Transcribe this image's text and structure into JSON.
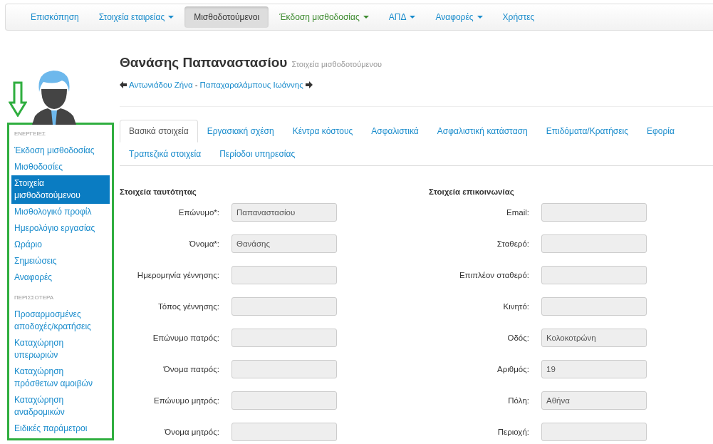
{
  "navbar": {
    "items": [
      {
        "label": "Επισκόπηση",
        "caret": false,
        "selected": false,
        "color": "#1a8ccc"
      },
      {
        "label": "Στοιχεία εταιρείας",
        "caret": true,
        "selected": false,
        "color": "#1a8ccc"
      },
      {
        "label": "Μισθοδοτούμενοι",
        "caret": false,
        "selected": true,
        "color": "#333333"
      },
      {
        "label": "Έκδοση μισθοδοσίας",
        "caret": true,
        "selected": false,
        "color": "#3c8a2e"
      },
      {
        "label": "ΑΠΔ",
        "caret": true,
        "selected": false,
        "color": "#1a8ccc"
      },
      {
        "label": "Αναφορές",
        "caret": true,
        "selected": false,
        "color": "#1a8ccc"
      },
      {
        "label": "Χρήστες",
        "caret": false,
        "selected": false,
        "color": "#1a8ccc"
      }
    ]
  },
  "sidebar": {
    "sections": [
      {
        "heading": "ΕΝΕΡΓΕΙΕΣ",
        "items": [
          {
            "label": "Έκδοση μισθοδοσίας",
            "selected": false
          },
          {
            "label": "Μισθοδοσίες",
            "selected": false
          },
          {
            "label": "Στοιχεία μισθοδοτούμενου",
            "selected": true
          },
          {
            "label": "Μισθολογικό προφίλ",
            "selected": false
          },
          {
            "label": "Ημερολόγιο εργασίας",
            "selected": false
          },
          {
            "label": "Ωράριο",
            "selected": false
          },
          {
            "label": "Σημειώσεις",
            "selected": false
          },
          {
            "label": "Αναφορές",
            "selected": false
          }
        ]
      },
      {
        "heading": "ΠΕΡΙΣΣΟΤΕΡΑ",
        "items": [
          {
            "label": "Προσαρμοσμένες αποδοχές/κρατήσεις",
            "selected": false
          },
          {
            "label": "Καταχώρηση υπερωριών",
            "selected": false
          },
          {
            "label": "Καταχώρηση πρόσθετων αμοιβών",
            "selected": false
          },
          {
            "label": "Καταχώρηση αναδρομικών",
            "selected": false
          },
          {
            "label": "Ειδικές παράμετροι",
            "selected": false
          }
        ]
      }
    ]
  },
  "header": {
    "title": "Θανάσης Παπαναστασίου",
    "subtitle": "Στοιχεία μισθοδοτούμενου",
    "prev": "Αντωνιάδου Ζήνα",
    "separator": "-",
    "next": "Παπαχαραλάμπους Ιωάννης"
  },
  "tabs": [
    {
      "label": "Βασικά στοιχεία",
      "selected": true
    },
    {
      "label": "Εργασιακή σχέση",
      "selected": false
    },
    {
      "label": "Κέντρα κόστους",
      "selected": false
    },
    {
      "label": "Ασφαλιστικά",
      "selected": false
    },
    {
      "label": "Ασφαλιστική κατάσταση",
      "selected": false
    },
    {
      "label": "Επιδόματα/Κρατήσεις",
      "selected": false
    },
    {
      "label": "Εφορία",
      "selected": false
    },
    {
      "label": "Τραπεζικά στοιχεία",
      "selected": false
    },
    {
      "label": "Περίοδοι υπηρεσίας",
      "selected": false
    }
  ],
  "sections": [
    {
      "title": "Στοιχεία ταυτότητας",
      "fields": [
        {
          "label": "Επώνυμο*:",
          "value": "Παπαναστασίου"
        },
        {
          "label": "Όνομα*:",
          "value": "Θανάσης"
        },
        {
          "label": "Ημερομηνία γέννησης:"
        },
        {
          "label": "Τόπος γέννησης:"
        },
        {
          "label": "Επώνυμο πατρός:"
        },
        {
          "label": "Όνομα πατρός:"
        },
        {
          "label": "Επώνυμο μητρός:"
        },
        {
          "label": "Όνομα μητρός:"
        }
      ]
    },
    {
      "title": "Στοιχεία επικοινωνίας",
      "fields": [
        {
          "label": "Email:"
        },
        {
          "label": "Σταθερό:"
        },
        {
          "label": "Επιπλέον σταθερό:"
        },
        {
          "label": "Κινητό:"
        },
        {
          "label": "Οδός:",
          "value": "Κολοκοτρώνη"
        },
        {
          "label": "Αριθμός:",
          "value": "19"
        },
        {
          "label": "Πόλη:",
          "value": "Αθήνα"
        },
        {
          "label": "Περιοχή:"
        }
      ]
    }
  ]
}
